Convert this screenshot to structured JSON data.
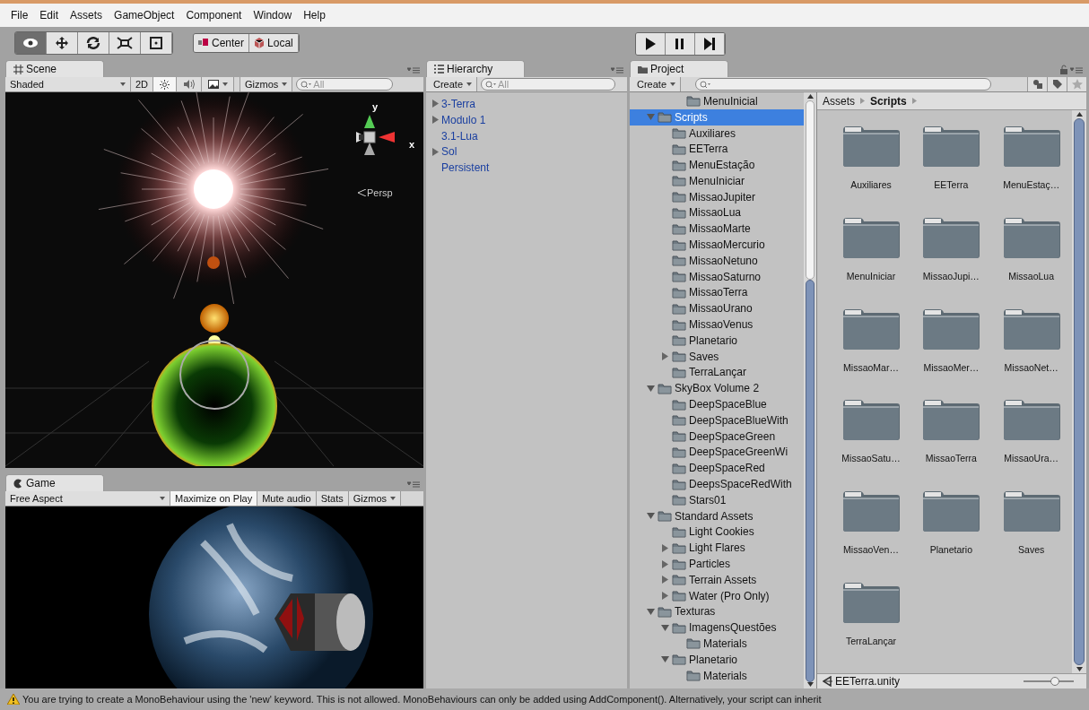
{
  "menu": [
    "File",
    "Edit",
    "Assets",
    "GameObject",
    "Component",
    "Window",
    "Help"
  ],
  "toolbar": {
    "tools": [
      {
        "kind": "view",
        "selected": true
      },
      {
        "kind": "move",
        "selected": false
      },
      {
        "kind": "rotate",
        "selected": false
      },
      {
        "kind": "scale",
        "selected": false
      },
      {
        "kind": "rect",
        "selected": false
      }
    ],
    "pivot": [
      {
        "kind": "pivot",
        "label": "Center"
      },
      {
        "kind": "space",
        "label": "Local"
      }
    ],
    "playback": [
      {
        "kind": "play"
      },
      {
        "kind": "pause"
      },
      {
        "kind": "step"
      }
    ]
  },
  "scene": {
    "tab": "Scene",
    "shading": "Shaded",
    "mode_2d": "2D",
    "lighting_on": true,
    "audio_on": false,
    "gizmos": "Gizmos",
    "search_placeholder": "All",
    "axis_y": "y",
    "axis_x": "x",
    "projection": "Persp"
  },
  "game": {
    "tab": "Game",
    "aspect": "Free Aspect",
    "toggles": [
      {
        "label": "Maximize on Play",
        "on": true
      },
      {
        "label": "Mute audio",
        "on": false
      },
      {
        "label": "Stats",
        "on": false
      }
    ],
    "gizmos": "Gizmos"
  },
  "hierarchy": {
    "tab": "Hierarchy",
    "create": "Create",
    "search_placeholder": "All",
    "items": [
      {
        "label": "3-Terra",
        "expanded": false,
        "selected": false
      },
      {
        "label": "Modulo 1",
        "expanded": false,
        "selected": false
      },
      {
        "label": "3.1-Lua",
        "selected": false
      },
      {
        "label": "Sol",
        "expanded": false,
        "selected": false
      },
      {
        "label": "Persistent",
        "selected": false
      }
    ]
  },
  "project": {
    "tab": "Project",
    "create": "Create",
    "breadcrumb": [
      "Assets",
      "Scripts"
    ],
    "tree_top": [
      {
        "label": "MenuInicial",
        "selected": false
      }
    ],
    "tree": [
      {
        "label": "Scripts",
        "expanded": true,
        "selected": true,
        "children": [
          {
            "label": "Auxiliares",
            "selected": false
          },
          {
            "label": "EETerra",
            "selected": false
          },
          {
            "label": "MenuEstação",
            "selected": false
          },
          {
            "label": "MenuIniciar",
            "selected": false
          },
          {
            "label": "MissaoJupiter",
            "selected": false
          },
          {
            "label": "MissaoLua",
            "selected": false
          },
          {
            "label": "MissaoMarte",
            "selected": false
          },
          {
            "label": "MissaoMercurio",
            "selected": false
          },
          {
            "label": "MissaoNetuno",
            "selected": false
          },
          {
            "label": "MissaoSaturno",
            "selected": false
          },
          {
            "label": "MissaoTerra",
            "selected": false
          },
          {
            "label": "MissaoUrano",
            "selected": false
          },
          {
            "label": "MissaoVenus",
            "selected": false
          },
          {
            "label": "Planetario",
            "selected": false
          },
          {
            "label": "Saves",
            "expanded": false,
            "selected": false
          },
          {
            "label": "TerraLançar",
            "selected": false
          }
        ]
      },
      {
        "label": "SkyBox Volume 2",
        "expanded": true,
        "selected": false,
        "children": [
          {
            "label": "DeepSpaceBlue",
            "selected": false
          },
          {
            "label": "DeepSpaceBlueWith",
            "selected": false
          },
          {
            "label": "DeepSpaceGreen",
            "selected": false
          },
          {
            "label": "DeepSpaceGreenWi",
            "selected": false
          },
          {
            "label": "DeepSpaceRed",
            "selected": false
          },
          {
            "label": "DeepsSpaceRedWith",
            "selected": false
          },
          {
            "label": "Stars01",
            "selected": false
          }
        ]
      },
      {
        "label": "Standard Assets",
        "expanded": true,
        "selected": false,
        "children": [
          {
            "label": "Light Cookies",
            "selected": false
          },
          {
            "label": "Light Flares",
            "expanded": false,
            "selected": false
          },
          {
            "label": "Particles",
            "expanded": false,
            "selected": false
          },
          {
            "label": "Terrain Assets",
            "expanded": false,
            "selected": false
          },
          {
            "label": "Water (Pro Only)",
            "expanded": false,
            "selected": false
          }
        ]
      },
      {
        "label": "Texturas",
        "expanded": true,
        "selected": false,
        "children": [
          {
            "label": "ImagensQuestões",
            "expanded": true,
            "selected": false,
            "children": [
              {
                "label": "Materials",
                "selected": false
              }
            ]
          },
          {
            "label": "Planetario",
            "expanded": true,
            "selected": false,
            "children": [
              {
                "label": "Materials",
                "selected": false
              }
            ]
          }
        ]
      }
    ],
    "grid": [
      {
        "label": "Auxiliares",
        "selected": false
      },
      {
        "label": "EETerra",
        "selected": false
      },
      {
        "label": "MenuEstaç…",
        "selected": false
      },
      {
        "label": "MenuIniciar",
        "selected": false
      },
      {
        "label": "MissaoJupi…",
        "selected": false
      },
      {
        "label": "MissaoLua",
        "selected": false
      },
      {
        "label": "MissaoMar…",
        "selected": false
      },
      {
        "label": "MissaoMer…",
        "selected": false
      },
      {
        "label": "MissaoNet…",
        "selected": false
      },
      {
        "label": "MissaoSatu…",
        "selected": false
      },
      {
        "label": "MissaoTerra",
        "selected": false
      },
      {
        "label": "MissaoUra…",
        "selected": false
      },
      {
        "label": "MissaoVen…",
        "selected": false
      },
      {
        "label": "Planetario",
        "selected": false
      },
      {
        "label": "Saves",
        "selected": false
      },
      {
        "label": "TerraLançar",
        "selected": false
      }
    ],
    "footer_file": "EETerra.unity",
    "zoom_slider": {
      "level": 0.62
    }
  },
  "status_bar": {
    "message": "You are trying to create a MonoBehaviour using the 'new' keyword.  This is not allowed.  MonoBehaviours can only be added using AddComponent().  Alternatively, your script can inherit"
  }
}
